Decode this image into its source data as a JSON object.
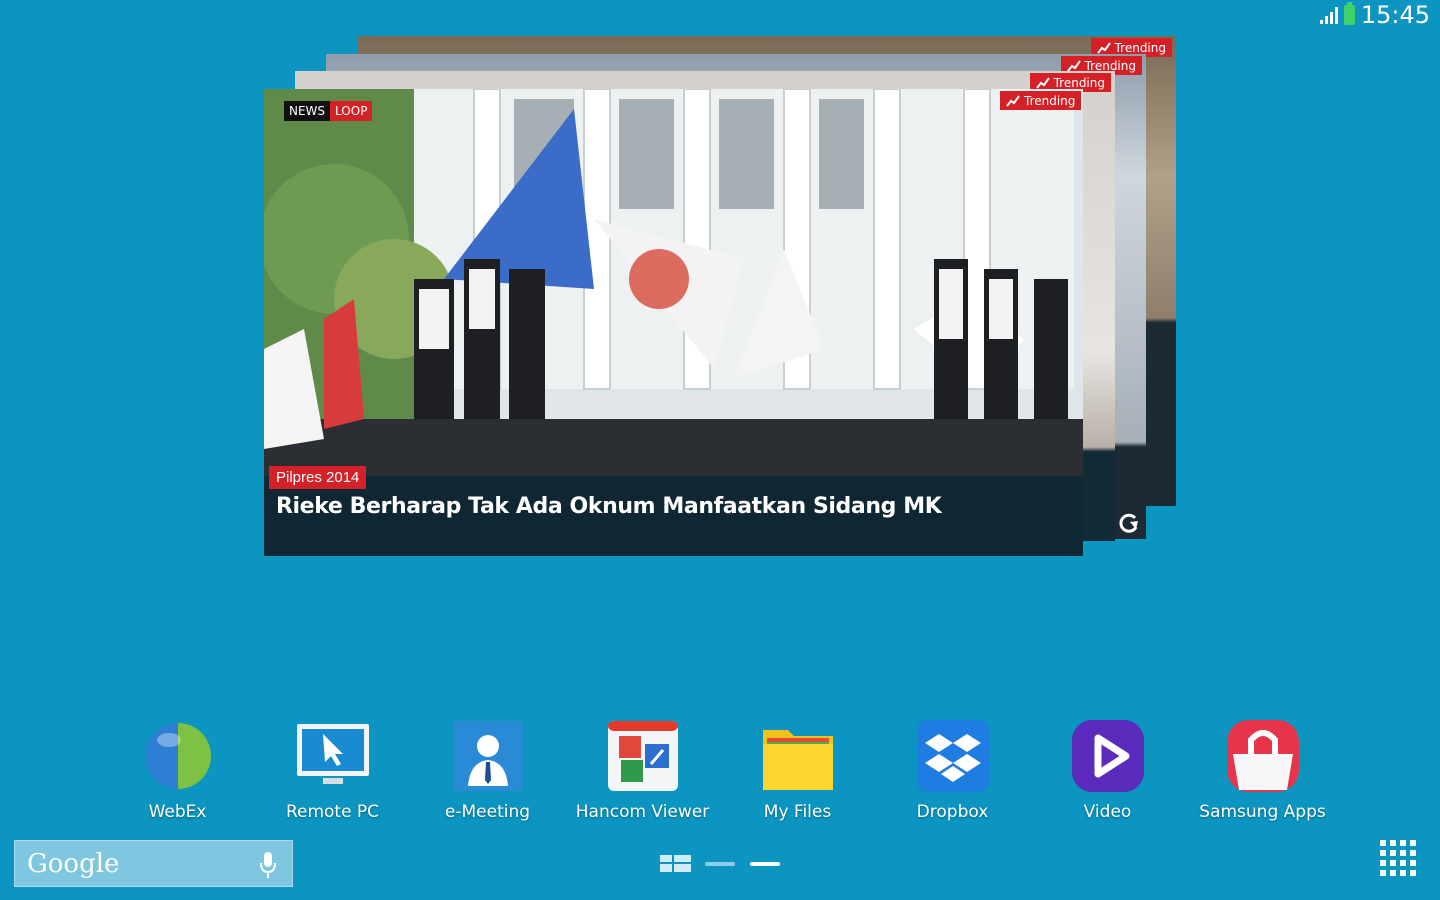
{
  "status_bar": {
    "time": "15:45",
    "signal_icon": "signal-strength-icon",
    "battery_icon": "battery-icon"
  },
  "news_widget": {
    "brand_news": "NEWS",
    "brand_loop": "LOOP",
    "trending_labels": [
      "Trending",
      "Trending",
      "Trending",
      "Trending"
    ],
    "category": "Pilpres 2014",
    "headline": "Rieke Berharap Tak Ada Oknum Manfaatkan Sidang MK",
    "refresh_icon": "refresh-icon",
    "accent_color": "#d42127"
  },
  "dock": {
    "apps": [
      {
        "label": "WebEx",
        "icon": "webex-globe-icon"
      },
      {
        "label": "Remote PC",
        "icon": "remote-pc-monitor-icon"
      },
      {
        "label": "e-Meeting",
        "icon": "e-meeting-person-icon"
      },
      {
        "label": "Hancom Viewer",
        "icon": "hancom-viewer-icon"
      },
      {
        "label": "My Files",
        "icon": "folder-icon"
      },
      {
        "label": "Dropbox",
        "icon": "dropbox-icon"
      },
      {
        "label": "Video",
        "icon": "video-play-icon"
      },
      {
        "label": "Samsung Apps",
        "icon": "samsung-apps-bag-icon"
      }
    ]
  },
  "search_bar": {
    "logo_text": "Google",
    "mic_icon": "microphone-icon"
  },
  "pager": {
    "page_count": 2,
    "current_page": 2
  },
  "wallpaper_color": "#0b95c0"
}
